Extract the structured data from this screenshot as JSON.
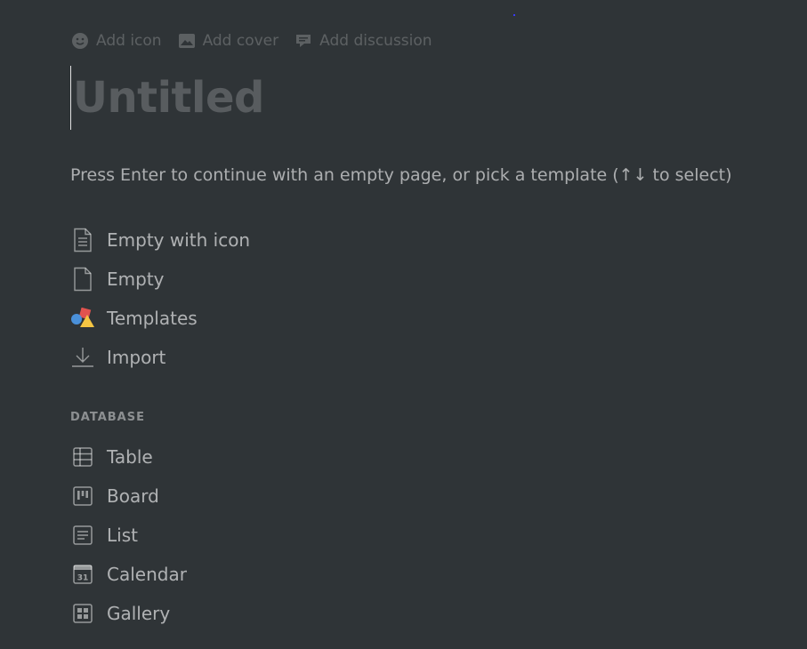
{
  "controls": {
    "add_icon": "Add icon",
    "add_cover": "Add cover",
    "add_discussion": "Add discussion"
  },
  "page": {
    "title_placeholder": "Untitled",
    "hint": "Press Enter to continue with an empty page, or pick a template (↑↓ to select)"
  },
  "templates": {
    "items": [
      {
        "label": "Empty with icon",
        "icon": "page-with-lines-icon"
      },
      {
        "label": "Empty",
        "icon": "blank-page-icon"
      },
      {
        "label": "Templates",
        "icon": "shapes-icon"
      },
      {
        "label": "Import",
        "icon": "download-icon"
      }
    ]
  },
  "database": {
    "heading": "DATABASE",
    "items": [
      {
        "label": "Table",
        "icon": "table-icon"
      },
      {
        "label": "Board",
        "icon": "board-icon"
      },
      {
        "label": "List",
        "icon": "list-icon"
      },
      {
        "label": "Calendar",
        "icon": "calendar-icon"
      },
      {
        "label": "Gallery",
        "icon": "gallery-icon"
      }
    ],
    "calendar_day": "31"
  },
  "colors": {
    "background": "#2f3437",
    "shape_red": "#e1534f",
    "shape_blue": "#4a90d9",
    "shape_yellow": "#f5c543"
  }
}
